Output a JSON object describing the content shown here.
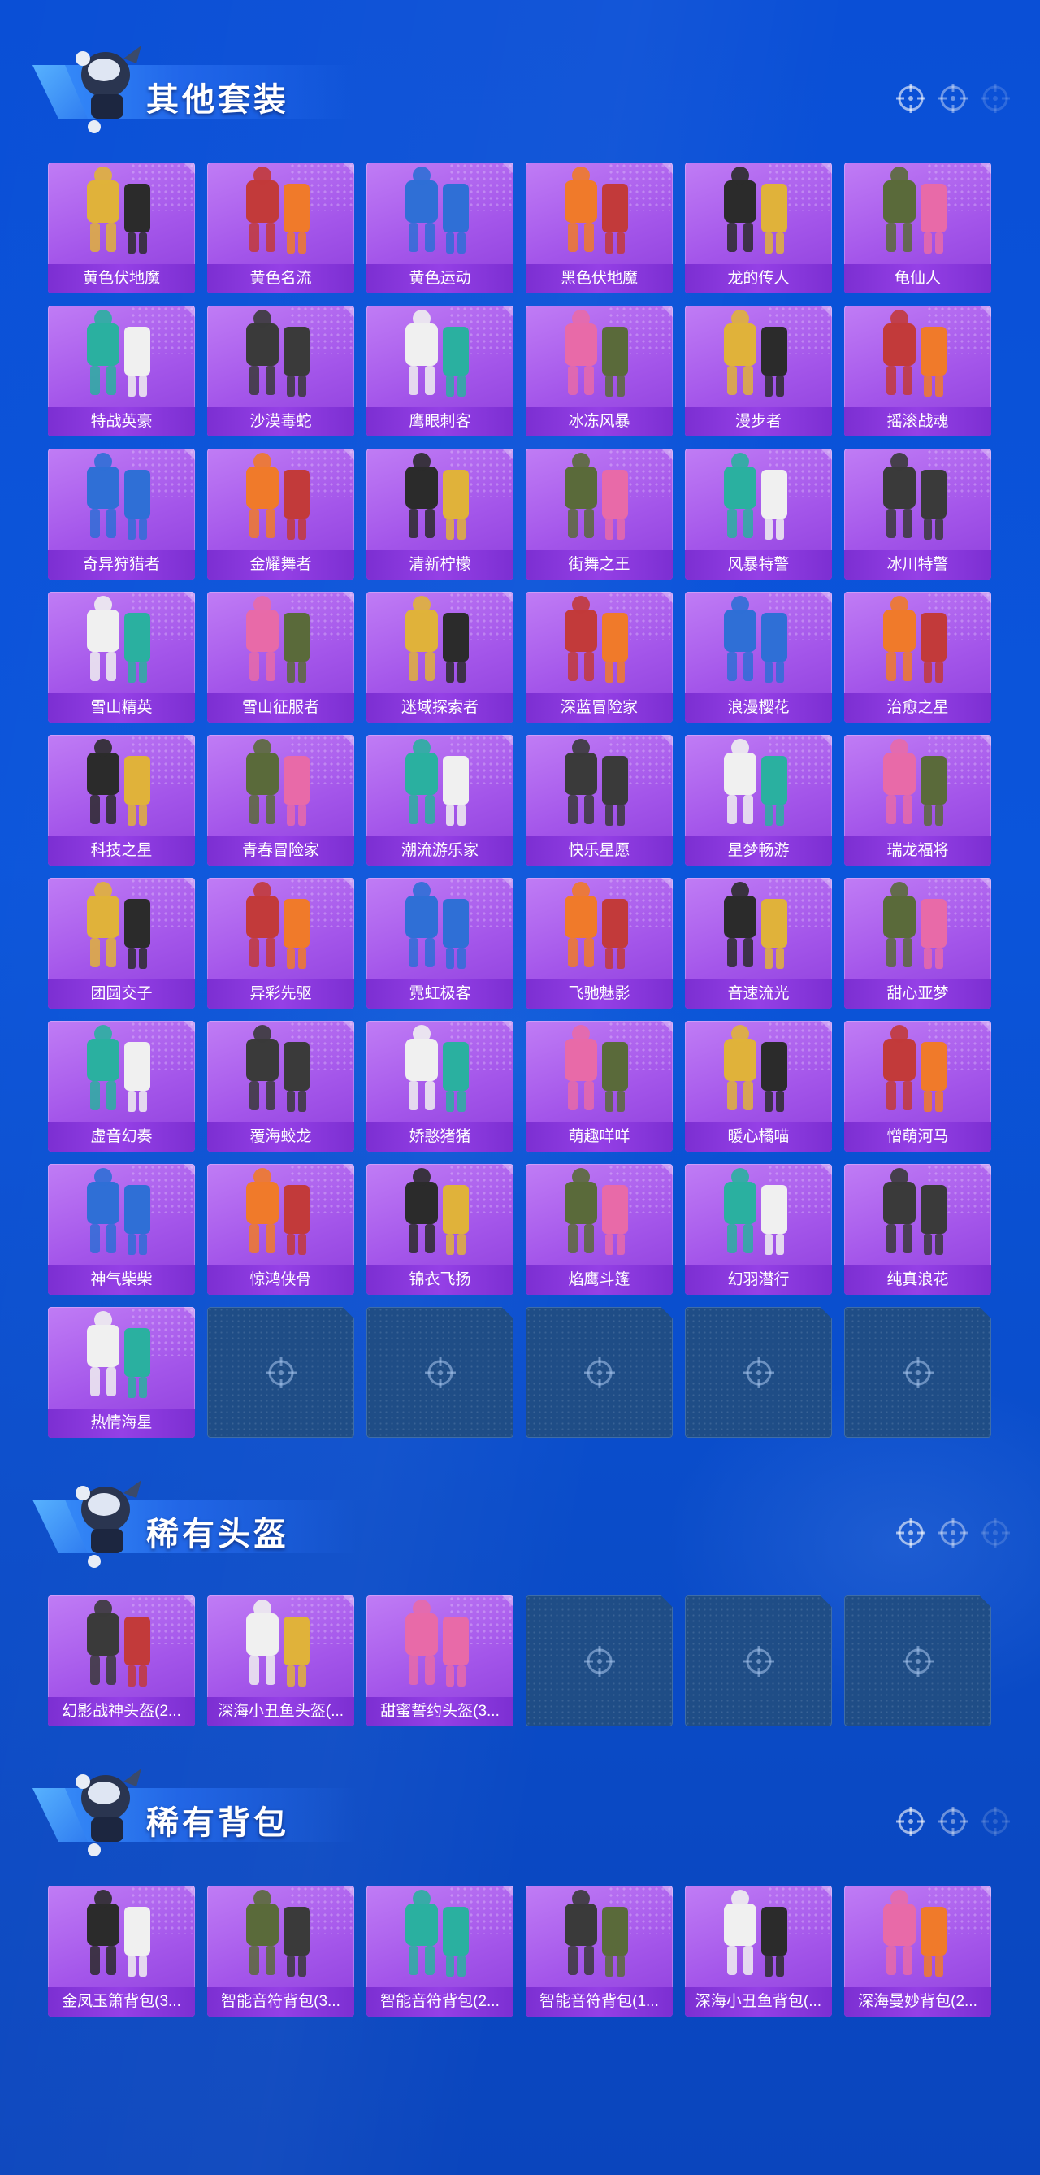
{
  "colors": {
    "background": "#0b55db",
    "card": "#a456ea",
    "label_bar": "#8a38de",
    "empty_slot": "#1f4d86"
  },
  "sections": [
    {
      "title": "其他套装",
      "items": [
        "黄色伏地魔",
        "黄色名流",
        "黄色运动",
        "黑色伏地魔",
        "龙的传人",
        "龟仙人",
        "特战英豪",
        "沙漠毒蛇",
        "鹰眼刺客",
        "冰冻风暴",
        "漫步者",
        "摇滚战魂",
        "奇异狩猎者",
        "金耀舞者",
        "清新柠檬",
        "街舞之王",
        "风暴特警",
        "冰川特警",
        "雪山精英",
        "雪山征服者",
        "迷域探索者",
        "深蓝冒险家",
        "浪漫樱花",
        "治愈之星",
        "科技之星",
        "青春冒险家",
        "潮流游乐家",
        "快乐星愿",
        "星梦畅游",
        "瑞龙福将",
        "团圆交子",
        "异彩先驱",
        "霓虹极客",
        "飞驰魅影",
        "音速流光",
        "甜心亚梦",
        "虚音幻奏",
        "覆海蛟龙",
        "娇憨猪猪",
        "萌趣咩咩",
        "暖心橘喵",
        "憎萌河马",
        "神气柴柴",
        "惊鸿侠骨",
        "锦衣飞扬",
        "焰鹰斗篷",
        "幻羽潜行",
        "纯真浪花",
        "热情海星"
      ],
      "empty_slots": 5
    },
    {
      "title": "稀有头盔",
      "items": [
        "幻影战神头盔(2...",
        "深海小丑鱼头盔(...",
        "甜蜜誓约头盔(3..."
      ],
      "empty_slots": 3
    },
    {
      "title": "稀有背包",
      "items": [
        "金凤玉箫背包(3...",
        "智能音符背包(3...",
        "智能音符背包(2...",
        "智能音符背包(1...",
        "深海小丑鱼背包(...",
        "深海曼妙背包(2..."
      ],
      "empty_slots": 0
    }
  ]
}
